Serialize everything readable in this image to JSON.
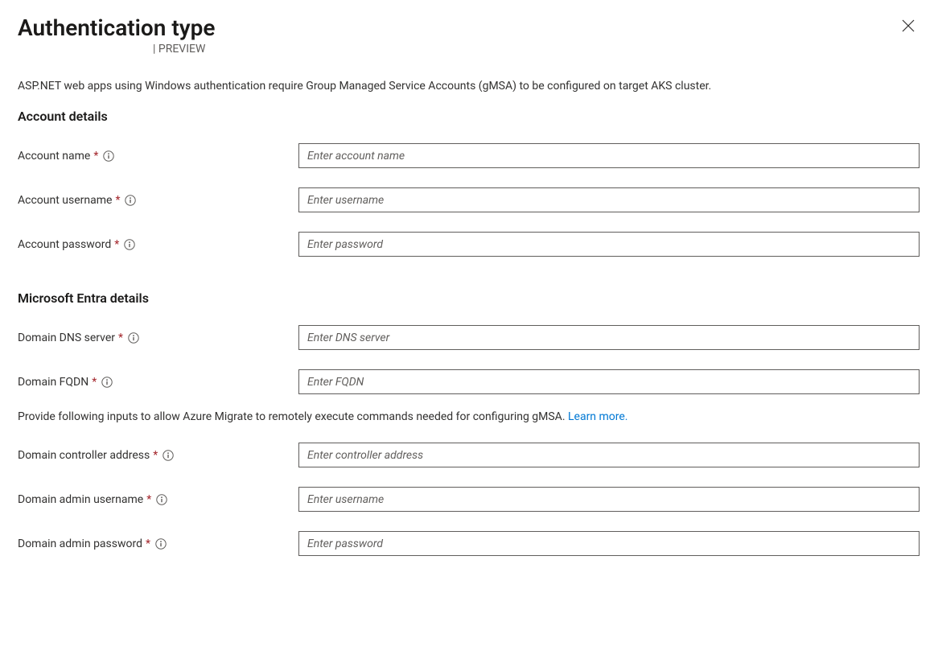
{
  "header": {
    "title": "Authentication type",
    "preview_badge": "PREVIEW"
  },
  "intro": "ASP.NET web apps using Windows authentication require Group Managed Service Accounts (gMSA) to be configured on target AKS cluster.",
  "sections": {
    "account": {
      "heading": "Account details",
      "fields": {
        "account_name": {
          "label": "Account name",
          "placeholder": "Enter account name"
        },
        "account_username": {
          "label": "Account username",
          "placeholder": "Enter username"
        },
        "account_password": {
          "label": "Account password",
          "placeholder": "Enter password"
        }
      }
    },
    "entra": {
      "heading": "Microsoft Entra details",
      "fields": {
        "domain_dns": {
          "label": "Domain DNS server",
          "placeholder": "Enter DNS server"
        },
        "domain_fqdn": {
          "label": "Domain FQDN",
          "placeholder": "Enter FQDN"
        },
        "domain_controller": {
          "label": "Domain controller address",
          "placeholder": "Enter controller address"
        },
        "domain_admin_user": {
          "label": "Domain admin username",
          "placeholder": "Enter username"
        },
        "domain_admin_pass": {
          "label": "Domain admin password",
          "placeholder": "Enter password"
        }
      },
      "helper_text": "Provide following inputs to allow Azure Migrate to remotely execute commands needed for configuring gMSA. ",
      "learn_more": "Learn more."
    }
  }
}
